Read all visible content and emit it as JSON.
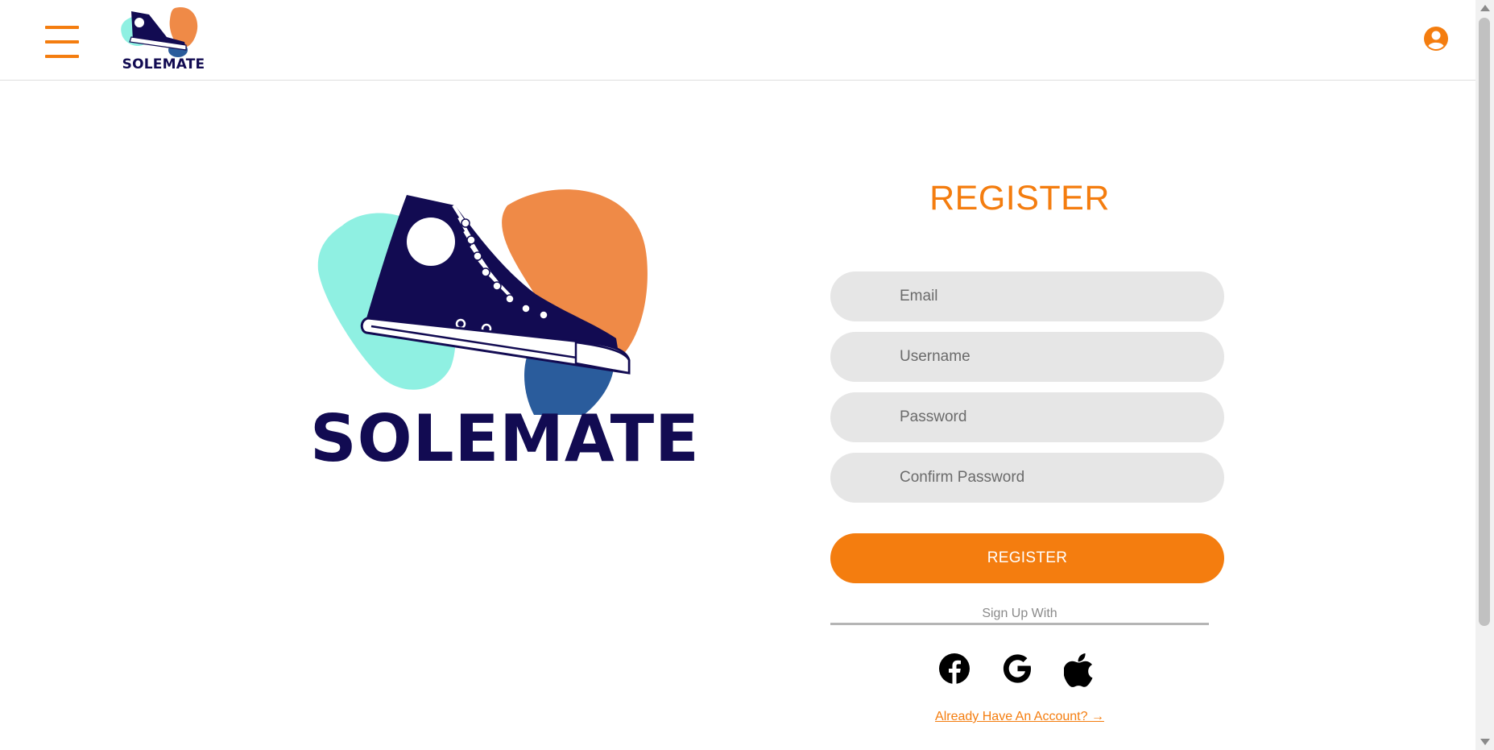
{
  "header": {
    "brand_name": "SOLEMATE"
  },
  "hero": {
    "brand_name": "SOLEMATE"
  },
  "form": {
    "title": "REGISTER",
    "email_placeholder": "Email",
    "username_placeholder": "Username",
    "password_placeholder": "Password",
    "confirm_password_placeholder": "Confirm Password",
    "register_label": "REGISTER",
    "signup_with_label": "Sign Up With",
    "login_link_label": "Already Have An Account? →"
  },
  "icons": {
    "menu": "hamburger-menu-icon",
    "user": "user-circle-icon",
    "facebook": "facebook-icon",
    "google": "google-icon",
    "apple": "apple-icon"
  },
  "colors": {
    "accent": "#f47d0f",
    "brand_navy": "#120b52",
    "logo_teal": "#8ff0e2",
    "logo_orange": "#ef8a47",
    "logo_blue": "#2a5c9c",
    "field_bg": "#e6e6e6"
  }
}
